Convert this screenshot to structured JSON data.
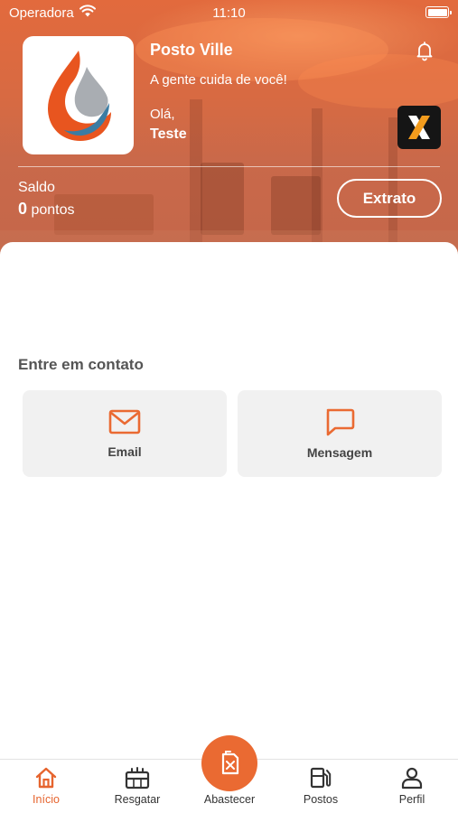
{
  "status_bar": {
    "carrier": "Operadora",
    "time": "11:10"
  },
  "header": {
    "station_name": "Posto Ville",
    "tagline": "A gente cuida de você!",
    "greeting": "Olá,",
    "username": "Teste",
    "balance_label": "Saldo",
    "balance_value": "0",
    "balance_unit": "pontos",
    "statement_button": "Extrato"
  },
  "contact": {
    "title": "Entre em contato",
    "email_label": "Email",
    "message_label": "Mensagem"
  },
  "tabs": [
    {
      "label": "Início",
      "icon": "home-icon",
      "active": true
    },
    {
      "label": "Resgatar",
      "icon": "gift-icon",
      "active": false
    },
    {
      "label": "Abastecer",
      "icon": "fuel-can-icon",
      "active": false
    },
    {
      "label": "Postos",
      "icon": "fuel-pump-icon",
      "active": false
    },
    {
      "label": "Perfil",
      "icon": "user-icon",
      "active": false
    }
  ],
  "colors": {
    "accent": "#EA6A32",
    "hero_tint": "#D86A42",
    "card_background": "#F1F1F1"
  }
}
